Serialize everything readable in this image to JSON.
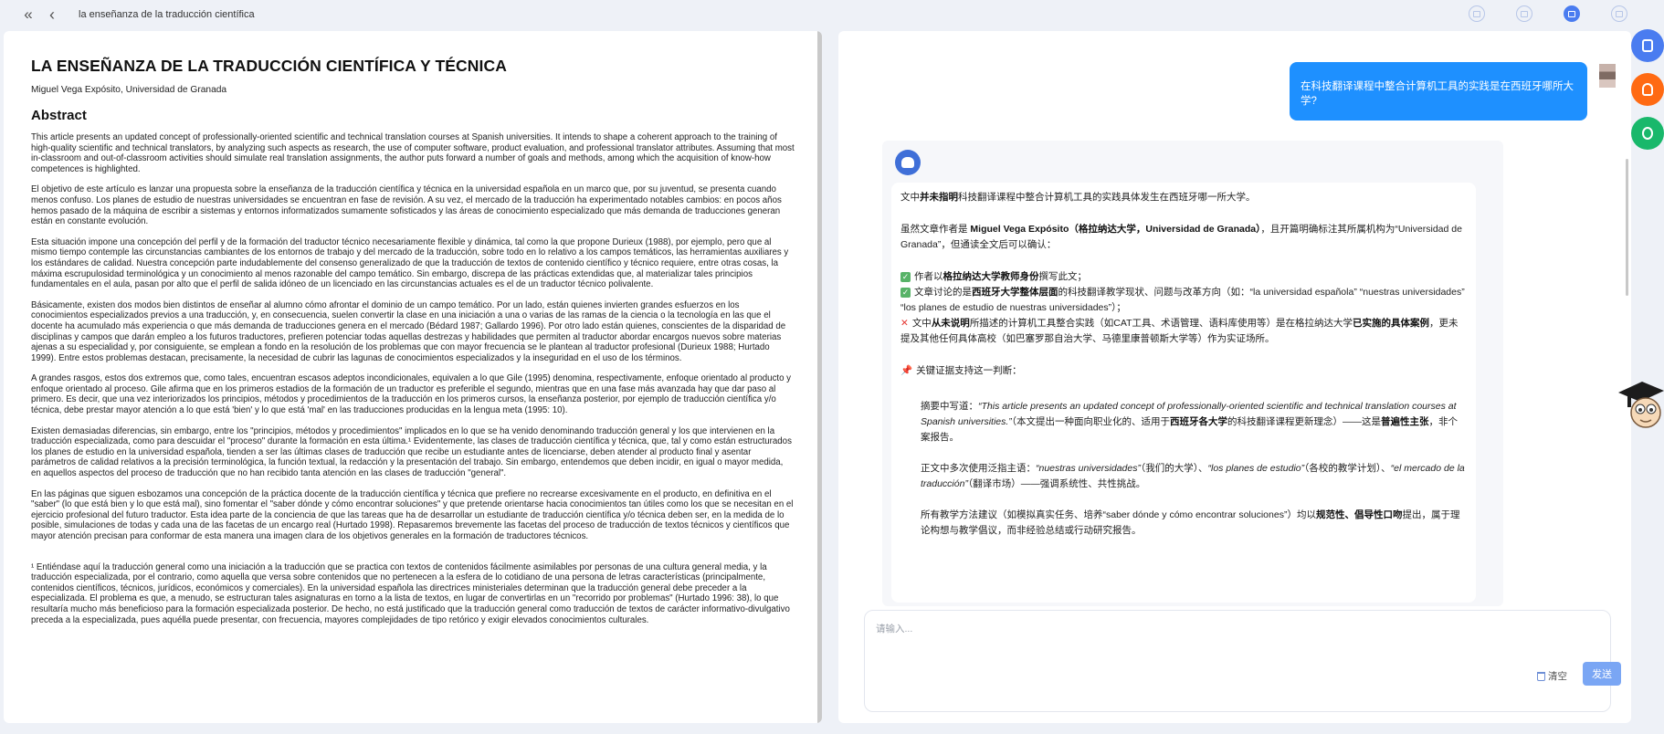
{
  "topbar": {
    "double_back_icon": "«",
    "back_icon": "‹",
    "title": "la enseñanza de la traducción científica"
  },
  "document": {
    "title": "LA ENSEÑANZA DE LA TRADUCCIÓN CIENTÍFICA Y TÉCNICA",
    "author": "Miguel Vega Expósito, Universidad de Granada",
    "abstract_heading": "Abstract",
    "paragraphs": [
      "This article presents an updated concept of professionally-oriented scientific and technical translation courses at Spanish universities. It intends to shape a coherent approach to the training of high-quality scientific and technical translators, by analyzing such aspects as research, the use of computer software, product evaluation, and professional translator attributes. Assuming that most in-classroom and out-of-classroom activities should simulate real translation assignments, the author puts forward a number of goals and methods, among which the acquisition of know-how competences is highlighted.",
      "El objetivo de este artículo es lanzar una propuesta sobre la enseñanza de la traducción científica y técnica en la universidad española en un marco que, por su juventud, se presenta cuando menos confuso. Los planes de estudio de nuestras universidades se encuentran en fase de revisión. A su vez, el mercado de la traducción ha experimentado notables cambios: en pocos años hemos pasado de la máquina de escribir a sistemas y entornos informatizados sumamente sofisticados y las áreas de conocimiento especializado que más demanda de traducciones generan están en constante evolución.",
      "Esta situación impone una concepción del perfil y de la formación del traductor técnico necesariamente flexible y dinámica, tal como la que propone Durieux (1988), por ejemplo, pero que al mismo tiempo contemple las circunstancias cambiantes de los entornos de trabajo y del mercado de la traducción, sobre todo en lo relativo a los campos temáticos, las herramientas auxiliares y los estándares de calidad. Nuestra concepción parte indudablemente del consenso generalizado de que la traducción de textos de contenido científico y técnico requiere, entre otras cosas, la máxima escrupulosidad terminológica y un conocimiento al menos razonable del campo temático. Sin embargo, discrepa de las prácticas extendidas que, al materializar tales principios fundamentales en el aula, pasan por alto que el perfil de salida idóneo de un licenciado en las circunstancias actuales es el de un traductor técnico polivalente.",
      "Básicamente, existen dos modos bien distintos de enseñar al alumno cómo afrontar el dominio de un campo temático. Por un lado, están quienes invierten grandes esfuerzos en los conocimientos especializados previos a una traducción, y, en consecuencia, suelen convertir la clase en una iniciación a una o varias de las ramas de la ciencia o la tecnología en las que el docente ha acumulado más experiencia o que más demanda de traducciones genera en el mercado (Bédard 1987; Gallardo 1996). Por otro lado están quienes, conscientes de la disparidad de disciplinas y campos que darán empleo a los futuros traductores, prefieren potenciar todas aquellas destrezas y habilidades que permiten al traductor abordar encargos nuevos sobre materias ajenas a su especialidad y, por consiguiente, se emplean a fondo en la resolución de los problemas que con mayor frecuencia se le plantean al traductor profesional (Durieux 1988; Hurtado 1999). Entre estos problemas destacan, precisamente, la necesidad de cubrir las lagunas de conocimientos especializados y la inseguridad en el uso de los términos.",
      "A grandes rasgos, estos dos extremos que, como tales, encuentran escasos adeptos incondicionales, equivalen a lo que Gile (1995) denomina, respectivamente, enfoque orientado al producto y enfoque orientado al proceso. Gile afirma que en los primeros estadios de la formación de un traductor es preferible el segundo, mientras que en una fase más avanzada hay que dar paso al primero. Es decir, que una vez interiorizados los principios, métodos y procedimientos de la traducción en los primeros cursos, la enseñanza posterior, por ejemplo de traducción científica y/o técnica, debe prestar mayor atención a lo que está 'bien' y lo que está 'mal' en las traducciones producidas en la lengua meta (1995: 10).",
      "Existen demasiadas diferencias, sin embargo, entre los \"principios, métodos y procedimientos\" implicados en lo que se ha venido denominando traducción general y los que intervienen en la traducción especializada, como para descuidar el \"proceso\" durante la formación en esta última.¹ Evidentemente, las clases de traducción científica y técnica, que, tal y como están estructurados los planes de estudio en la universidad española, tienden a ser las últimas clases de traducción que recibe un estudiante antes de licenciarse, deben atender al producto final y asentar parámetros de calidad relativos a la precisión terminológica, la función textual, la redacción y la presentación del trabajo. Sin embargo, entendemos que deben incidir, en igual o mayor medida, en aquellos aspectos del proceso de traducción que no han recibido tanta atención en las clases de traducción \"general\".",
      "En las páginas que siguen esbozamos una concepción de la práctica docente de la traducción científica y técnica que prefiere no recrearse excesivamente en el producto, en definitiva en el \"saber\" (lo que está bien y lo que está mal), sino fomentar el \"saber dónde y cómo encontrar soluciones\" y que pretende orientarse hacia conocimientos tan útiles como los que se necesitan en el ejercicio profesional del futuro traductor. Esta idea parte de la conciencia de que las tareas que ha de desarrollar un estudiante de traducción científica y/o técnica deben ser, en la medida de lo posible, simulaciones de todas y cada una de las facetas de un encargo real (Hurtado 1998). Repasaremos brevemente las facetas del proceso de traducción de textos técnicos y científicos que mayor atención precisan para conformar de esta manera una imagen clara de los objetivos generales en la formación de traductores técnicos."
    ],
    "footnote": "¹ Entiéndase aquí la traducción general como una iniciación a la traducción que se practica con textos de contenidos fácilmente asimilables por personas de una cultura general media, y la traducción especializada, por el contrario, como aquella que versa sobre contenidos que no pertenecen a la esfera de lo cotidiano de una persona de letras características (principalmente, contenidos científicos, técnicos, jurídicos, económicos y comerciales). En la universidad española las directrices ministeriales determinan que la traducción general debe preceder a la especializada. El problema es que, a menudo, se estructuran tales asignaturas en torno a la lista de textos, en lugar de convertirlas en un \"recorrido por problemas\" (Hurtado 1996: 38), lo que resultaría mucho más beneficioso para la formación especializada posterior. De hecho, no está justificado que la traducción general como traducción de textos de carácter informativo-divulgativo preceda a la especializada, pues aquélla puede presentar, con frecuencia, mayores complejidades de tipo retórico y exigir elevados conocimientos culturales."
  },
  "chat": {
    "user_question": "在科技翻译课程中整合计算机工具的实践是在西班牙哪所大学?",
    "ai": {
      "p1_a": "文中",
      "p1_b": "并未指明",
      "p1_c": "科技翻译课程中整合计算机工具的实践具体发生在西班牙哪一所大学。",
      "p2_a": "虽然文章作者是 ",
      "p2_b": "Miguel Vega Expósito（格拉纳达大学，Universidad de Granada）",
      "p2_c": "，且开篇明确标注其所属机构为“Universidad de Granada”，但通读全文后可以确认：",
      "c1_a": "作者以",
      "c1_b": "格拉纳达大学教师身份",
      "c1_c": "撰写此文；",
      "c2_a": "文章讨论的是",
      "c2_b": "西班牙大学整体层面",
      "c2_c": "的科技翻译教学现状、问题与改革方向（如：“la universidad española” “nuestras universidades” “los planes de estudio de nuestras universidades”）；",
      "x_a": "文中",
      "x_b": "从未说明",
      "x_c": "所描述的计算机工具整合实践（如CAT工具、术语管理、语料库使用等）是在格拉纳达大学",
      "x_d": "已实施的具体案例",
      "x_e": "，更未提及其他任何具体高校（如巴塞罗那自治大学、马德里康普顿斯大学等）作为实证场所。",
      "pin_label": "关键证据支持这一判断：",
      "q1_a": "摘要中写道：",
      "q1_b": "“This article presents an updated concept of professionally-oriented scientific and technical translation courses at Spanish universities.”",
      "q1_c": "（本文提出一种面向职业化的、适用于",
      "q1_d": "西班牙各大学",
      "q1_e": "的科技翻译课程更新理念）——这是",
      "q1_f": "普遍性主张",
      "q1_g": "，非个案报告。",
      "q2_a": "正文中多次使用泛指主语：",
      "q2_b": "“nuestras universidades”",
      "q2_c": "（我们的大学）、",
      "q2_d": "“los planes de estudio”",
      "q2_e": "（各校的教学计划）、",
      "q2_f": "“el mercado de la traducción”",
      "q2_g": "（翻译市场）——强调系统性、共性挑战。",
      "q3_a": "所有教学方法建议（如模拟真实任务、培养“saber dónde y cómo encontrar soluciones”）均以",
      "q3_b": "规范性、倡导性口吻",
      "q3_c": "提出，属于理论构想与教学倡议，而非经验总结或行动研究报告。"
    },
    "input_placeholder": "请输入...",
    "clear_label": "清空",
    "send_label": "发送"
  },
  "colors": {
    "accent": "#4a7cf0",
    "user_bubble": "#1e90ff",
    "send_button": "#7aa6f4",
    "side_blue": "#4a7cf0",
    "side_orange": "#ff6a13",
    "side_green": "#19b86b"
  }
}
